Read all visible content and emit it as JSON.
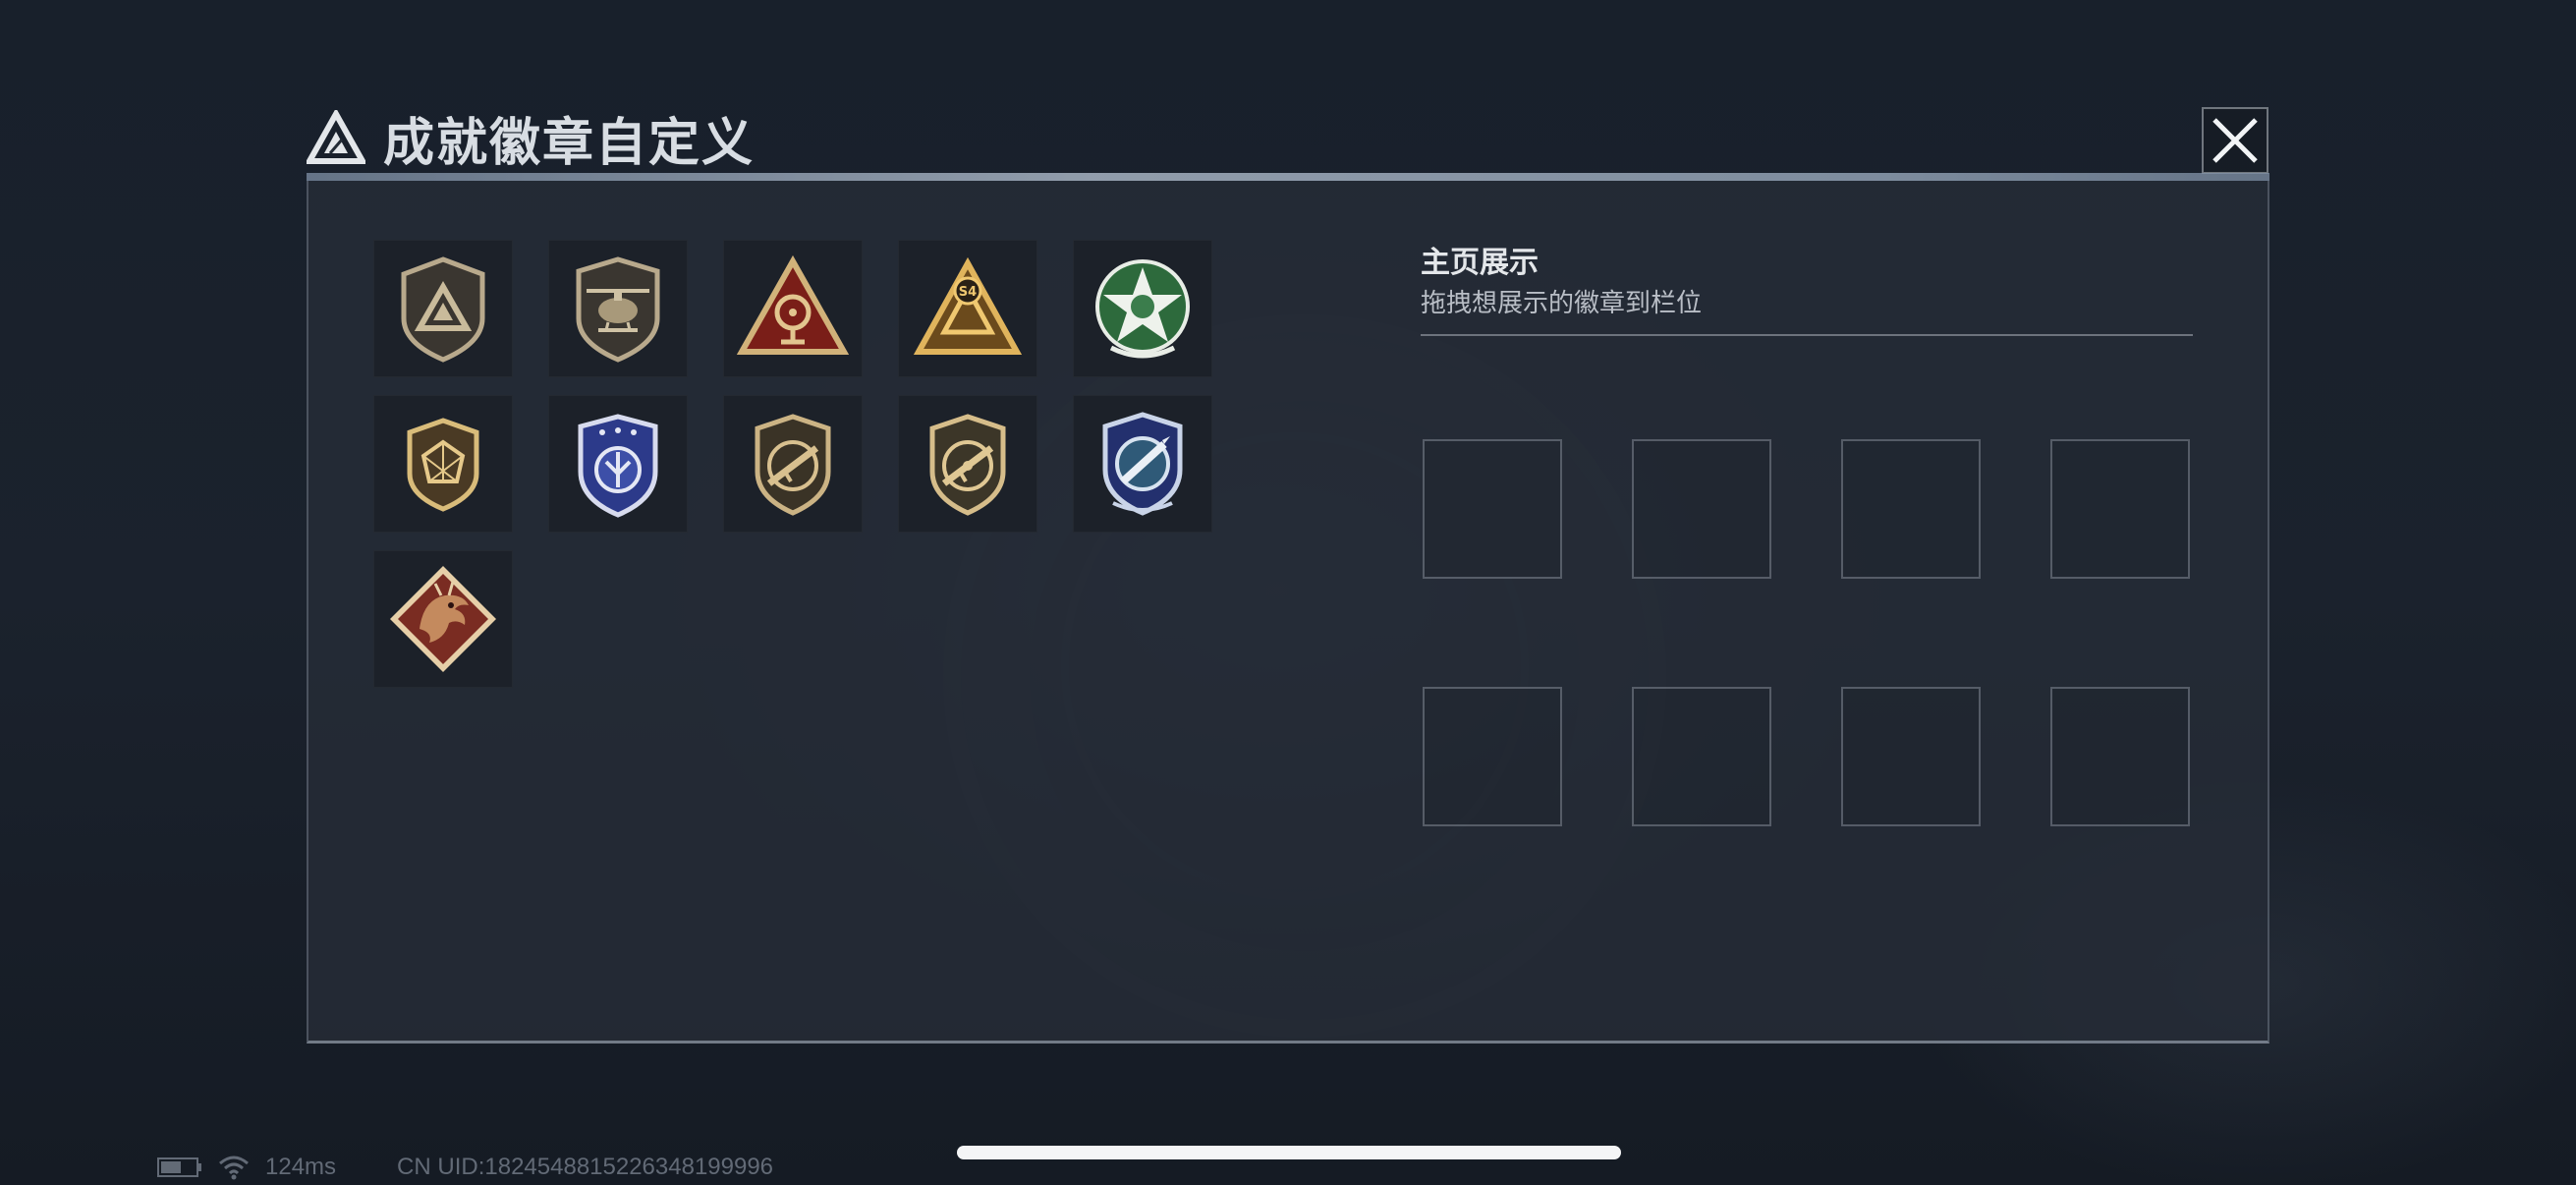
{
  "header": {
    "title": "成就徽章自定义",
    "logo_icon": "triangle-logo-icon",
    "close_icon": "close-icon"
  },
  "badges": [
    {
      "name": "badge-shield-logo",
      "icon": "shield-triangle-icon",
      "colors": [
        "#3a3630",
        "#b8a98c"
      ]
    },
    {
      "name": "badge-helicopter",
      "icon": "helicopter-shield-icon",
      "colors": [
        "#3a3630",
        "#b8a98c"
      ]
    },
    {
      "name": "badge-red-triangle-satellite",
      "icon": "satellite-triangle-icon",
      "colors": [
        "#7a1e18",
        "#d1b27a"
      ]
    },
    {
      "name": "badge-s4-triangle",
      "icon": "s4-triangle-icon",
      "colors": [
        "#6b4a1c",
        "#e0b45c"
      ]
    },
    {
      "name": "badge-green-star",
      "icon": "green-star-icon",
      "colors": [
        "#2d6a3c",
        "#e8ede6"
      ]
    },
    {
      "name": "badge-gold-polygon",
      "icon": "polygon-shield-icon",
      "colors": [
        "#4a3a24",
        "#d9bc7a"
      ]
    },
    {
      "name": "badge-blue-shield",
      "icon": "blue-shield-icon",
      "colors": [
        "#2c3a8a",
        "#d7dbee"
      ]
    },
    {
      "name": "badge-rifle-1",
      "icon": "rifle-shield-icon",
      "colors": [
        "#3a3326",
        "#cbb384"
      ]
    },
    {
      "name": "badge-rifle-2",
      "icon": "rifle-shield-icon",
      "colors": [
        "#3c3628",
        "#d6bd8a"
      ]
    },
    {
      "name": "badge-blue-rocket",
      "icon": "rocket-shield-icon",
      "colors": [
        "#23306e",
        "#c9d4e8"
      ]
    },
    {
      "name": "badge-dragon",
      "icon": "dragon-diamond-icon",
      "colors": [
        "#7a2c22",
        "#e6cfa8"
      ]
    }
  ],
  "showcase": {
    "title": "主页展示",
    "subtitle": "拖拽想展示的徽章到栏位",
    "slot_count": 8
  },
  "status_bar": {
    "battery_icon": "battery-icon",
    "wifi_icon": "wifi-icon",
    "ping": "124ms",
    "uid": "CN UID:1824548815226348199996"
  }
}
